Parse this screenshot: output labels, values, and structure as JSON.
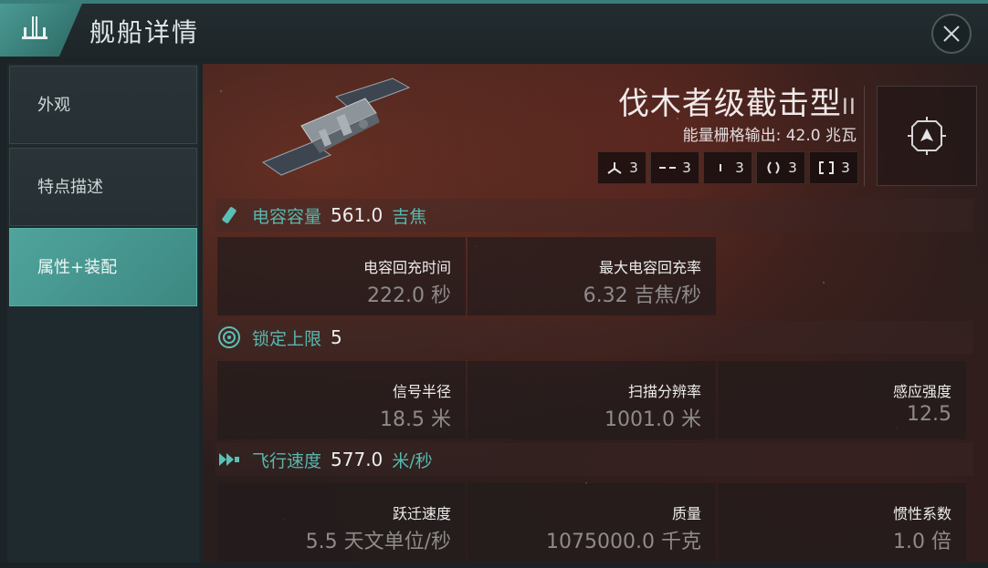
{
  "header": {
    "title": "舰船详情",
    "icon": "ship-class-icon",
    "close_icon": "close-icon"
  },
  "colors": {
    "accent": "#59b7ae",
    "active_tab": "#4fa49c",
    "header_badge": "#4b9a94"
  },
  "sidebar": {
    "items": [
      {
        "label": "外观",
        "active": false
      },
      {
        "label": "特点描述",
        "active": false
      },
      {
        "label": "属性+装配",
        "active": true
      }
    ]
  },
  "ship": {
    "name": "伐木者级截击型",
    "rank": "II",
    "power_label": "能量栅格输出:",
    "power_value": "42.0",
    "power_unit": "兆瓦",
    "slots": [
      {
        "icon": "high-slot-icon",
        "count": "3"
      },
      {
        "icon": "mid-slot-icon",
        "count": "3"
      },
      {
        "icon": "low-slot-icon",
        "count": "3"
      },
      {
        "icon": "rig-slot-icon",
        "count": "3"
      },
      {
        "icon": "drone-slot-icon",
        "count": "3"
      }
    ],
    "fitting_icon": "fitting-target-icon"
  },
  "sections": {
    "capacitor": {
      "icon": "capacitor-icon",
      "label": "电容容量",
      "value": "561.0",
      "unit": "吉焦",
      "stats": [
        {
          "name": "电容回充时间",
          "value": "222.0 秒"
        },
        {
          "name": "最大电容回充率",
          "value": "6.32 吉焦/秒"
        }
      ]
    },
    "targeting": {
      "icon": "target-lock-icon",
      "label": "锁定上限",
      "value": "5",
      "unit": "",
      "stats": [
        {
          "name": "信号半径",
          "value": "18.5 米"
        },
        {
          "name": "扫描分辨率",
          "value": "1001.0 米"
        },
        {
          "name": "感应强度",
          "value": "12.5"
        }
      ]
    },
    "speed": {
      "icon": "velocity-icon",
      "label": "飞行速度",
      "value": "577.0",
      "unit": "米/秒",
      "stats": [
        {
          "name": "跃迁速度",
          "value": "5.5 天文单位/秒"
        },
        {
          "name": "质量",
          "value": "1075000.0 千克"
        },
        {
          "name": "惯性系数",
          "value": "1.0 倍"
        }
      ]
    }
  }
}
